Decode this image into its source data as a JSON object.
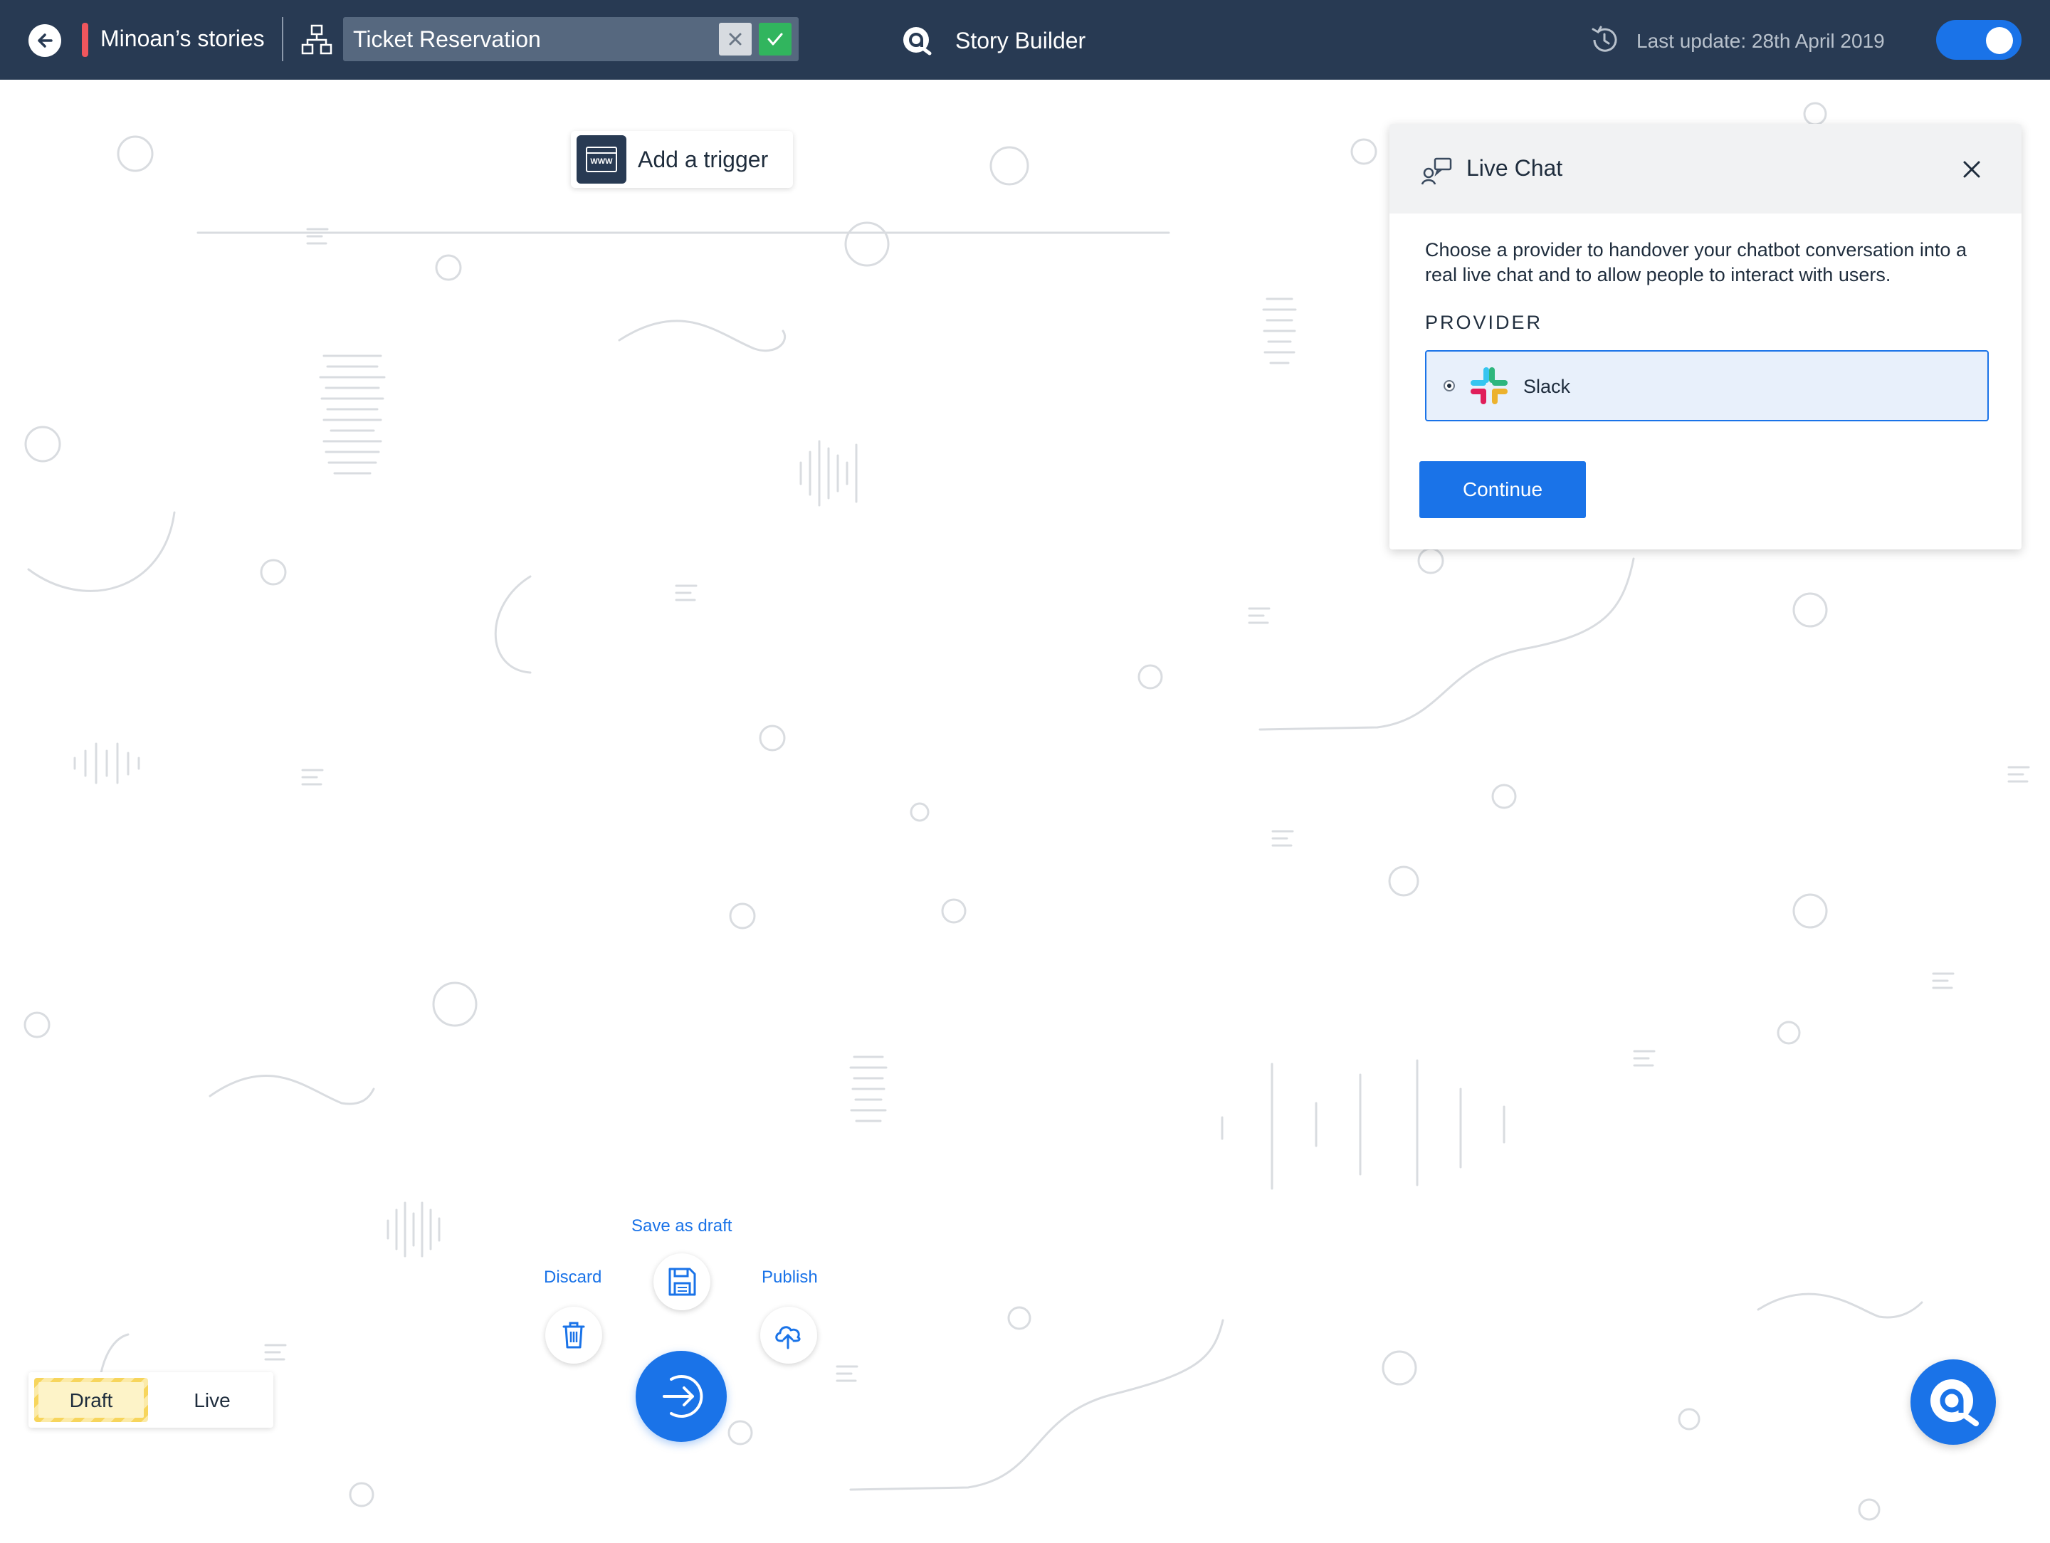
{
  "header": {
    "project_name": "Minoan’s stories",
    "story_name": "Ticket Reservation",
    "app_title": "Story Builder",
    "last_update": "Last update: 28th April 2019",
    "toggle_on": true,
    "accent_color": "#1a73e8",
    "bar_color": "#283a53",
    "marker_color": "#f0565d"
  },
  "canvas": {
    "trigger_label": "Add a trigger",
    "trigger_icon_text": "WWW"
  },
  "panel": {
    "title": "Live Chat",
    "description": "Choose a provider to handover your chatbot conversation into a real live chat and to allow people to interact with users.",
    "provider_heading": "PROVIDER",
    "providers": [
      {
        "label": "Slack",
        "selected": true
      }
    ],
    "continue_label": "Continue"
  },
  "actions": {
    "save_draft_label": "Save as draft",
    "discard_label": "Discard",
    "publish_label": "Publish"
  },
  "mode": {
    "draft_label": "Draft",
    "live_label": "Live",
    "active": "Draft"
  }
}
